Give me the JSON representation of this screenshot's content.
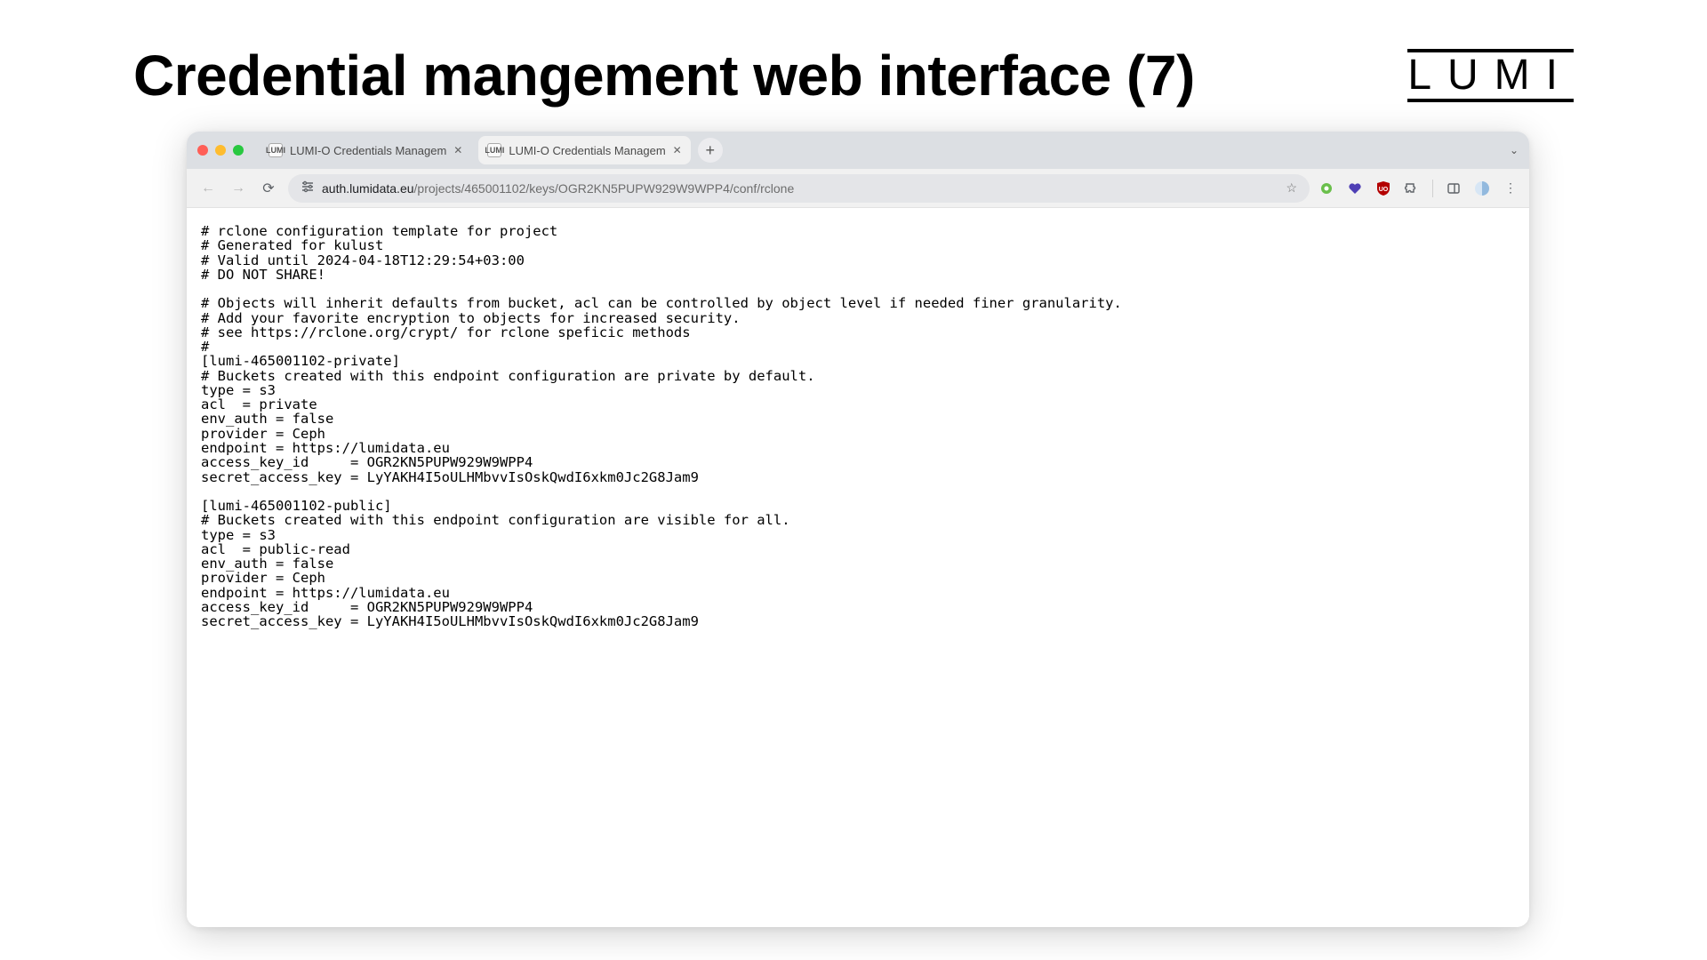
{
  "slide": {
    "title": "Credential mangement web interface (7)",
    "logo": "LUMI"
  },
  "browser": {
    "tabs": [
      {
        "favicon": "LUMI",
        "title": "LUMI-O Credentials Managem",
        "active": false
      },
      {
        "favicon": "LUMI",
        "title": "LUMI-O Credentials Managem",
        "active": true
      }
    ],
    "new_tab_label": "+",
    "chevron": "⌄",
    "nav": {
      "back": "←",
      "forward": "→",
      "reload": "⟳"
    },
    "address": {
      "tune_glyph": "⚙",
      "domain": "auth.lumidata.eu",
      "path": "/projects/465001102/keys/OGR2KN5PUPW929W9WPP4/conf/rclone",
      "star": "☆"
    },
    "extensions": {
      "ext1": "✦",
      "ext2": "❤",
      "ext3": "UO",
      "puzzle": "🧩",
      "panel": "▣",
      "avatar": "◐",
      "menu": "⋮"
    }
  },
  "config_text": "# rclone configuration template for project\n# Generated for kulust\n# Valid until 2024-04-18T12:29:54+03:00\n# DO NOT SHARE!\n\n# Objects will inherit defaults from bucket, acl can be controlled by object level if needed finer granularity.\n# Add your favorite encryption to objects for increased security.\n# see https://rclone.org/crypt/ for rclone speficic methods\n#\n[lumi-465001102-private]\n# Buckets created with this endpoint configuration are private by default.\ntype = s3\nacl  = private\nenv_auth = false\nprovider = Ceph\nendpoint = https://lumidata.eu\naccess_key_id     = OGR2KN5PUPW929W9WPP4\nsecret_access_key = LyYAKH4I5oULHMbvvIsOskQwdI6xkm0Jc2G8Jam9\n\n[lumi-465001102-public]\n# Buckets created with this endpoint configuration are visible for all.\ntype = s3\nacl  = public-read\nenv_auth = false\nprovider = Ceph\nendpoint = https://lumidata.eu\naccess_key_id     = OGR2KN5PUPW929W9WPP4\nsecret_access_key = LyYAKH4I5oULHMbvvIsOskQwdI6xkm0Jc2G8Jam9"
}
